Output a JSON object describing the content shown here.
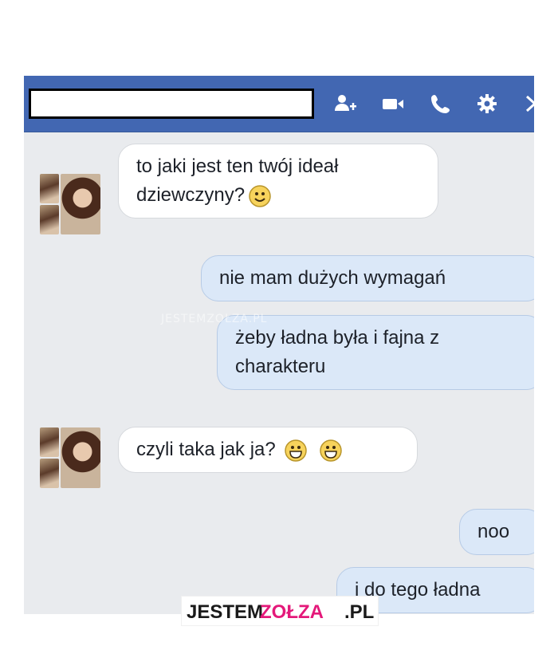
{
  "header": {
    "name_box": "",
    "icons": [
      "add-friend-icon",
      "video-call-icon",
      "phone-icon",
      "gear-icon",
      "close-icon"
    ],
    "color": "#4267b2"
  },
  "messages": [
    {
      "side": "received",
      "lines": [
        "to jaki jest ten twój ideał",
        "dziewczyny?"
      ],
      "emoji": 1
    },
    {
      "side": "sent",
      "lines": [
        "nie mam dużych wymagań"
      ],
      "emoji": 0
    },
    {
      "side": "sent",
      "lines": [
        "żeby ładna była i fajna z",
        "charakteru"
      ],
      "emoji": 0
    },
    {
      "side": "received",
      "lines": [
        "czyli taka jak ja?"
      ],
      "emoji": 2
    },
    {
      "side": "sent",
      "lines": [
        "noo"
      ],
      "emoji": 0
    },
    {
      "side": "sent",
      "lines": [
        "i do tego ładna"
      ],
      "emoji": 0
    }
  ],
  "watermark": {
    "mid": "JESTEMZOŁZA.PL",
    "banner_a": "JESTEM",
    "banner_b": "ZOŁZA",
    "banner_c": ".PL"
  },
  "colors": {
    "received_bubble": "#ffffff",
    "sent_bubble": "#dbe8f8",
    "chat_background": "#e9ebee",
    "brand_pink": "#e4197a"
  }
}
